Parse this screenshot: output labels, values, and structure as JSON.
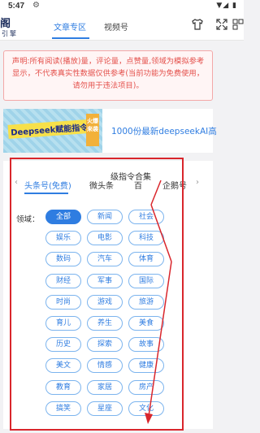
{
  "status": {
    "time": "5:47",
    "icons": [
      "gear-icon",
      "wifi-icon",
      "signal-icon",
      "battery-icon"
    ]
  },
  "header": {
    "logo_top": "阁",
    "logo_bottom": "引擎",
    "tabs": [
      {
        "label": "文章专区",
        "active": true
      },
      {
        "label": "视频号",
        "active": false
      }
    ],
    "right_icons": [
      "shirt-icon",
      "fullscreen-icon",
      "grid-icon"
    ]
  },
  "notice": {
    "text": "声明:所有阅读(播放)量，评论量，点赞量,领域为模拟参考显示，不代表真实性数据仅供参考(当前功能为免费使用，请勿用于违法项目)。"
  },
  "banner": {
    "image_text": "Deepseek赋能指令集",
    "image_badge": "火爆来袭",
    "link_text": "1000份最新deepseekAI高"
  },
  "overlay_text": "级指令合集",
  "platform_tabs": [
    {
      "label": "头条号(免费)",
      "active": true
    },
    {
      "label": "微头条",
      "active": false
    },
    {
      "label": "百",
      "active": false
    },
    {
      "label": "企鹅号",
      "active": false
    }
  ],
  "domain_label": "领域：",
  "domains": [
    "全部",
    "新闻",
    "社会",
    "娱乐",
    "电影",
    "科技",
    "数码",
    "汽车",
    "体育",
    "财经",
    "军事",
    "国际",
    "时尚",
    "游戏",
    "旅游",
    "育儿",
    "养生",
    "美食",
    "历史",
    "探索",
    "故事",
    "美文",
    "情感",
    "健康",
    "教育",
    "家居",
    "房产",
    "搞笑",
    "星座",
    "文化"
  ],
  "selected_domain": "全部",
  "colors": {
    "accent": "#2f7de1",
    "warning": "#e4514c",
    "annotation": "#d9262c"
  }
}
